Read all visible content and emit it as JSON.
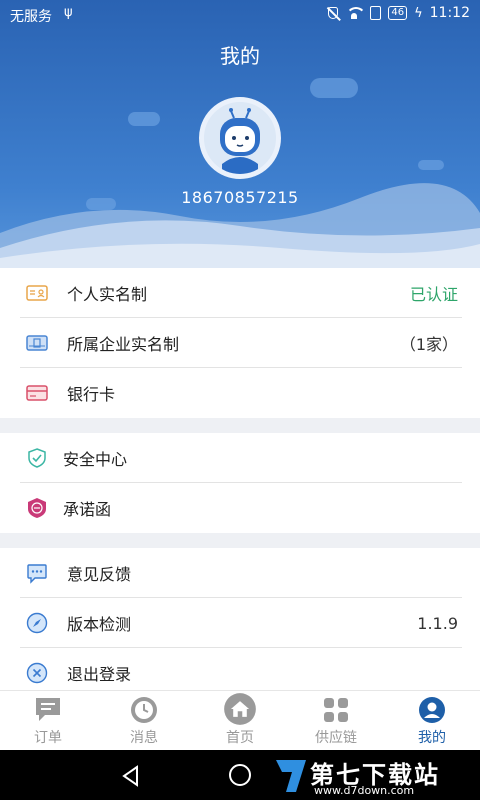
{
  "status_bar": {
    "carrier": "无服务",
    "usb_icon": "usb-icon",
    "network": "46",
    "time": "11:12"
  },
  "header": {
    "title": "我的",
    "phone": "18670857215"
  },
  "groups": [
    {
      "items": [
        {
          "label": "个人实名制",
          "value": "已认证",
          "icon": "id-card-icon"
        },
        {
          "label": "所属企业实名制",
          "value": "（1家）",
          "icon": "company-card-icon"
        },
        {
          "label": "银行卡",
          "value": "",
          "icon": "bank-card-icon"
        }
      ]
    },
    {
      "items": [
        {
          "label": "安全中心",
          "icon": "shield-check-icon"
        },
        {
          "label": "承诺函",
          "icon": "commitment-badge-icon"
        }
      ]
    },
    {
      "items": [
        {
          "label": "意见反馈",
          "icon": "feedback-icon"
        },
        {
          "label": "版本检测",
          "value": "1.1.9",
          "icon": "compass-icon"
        },
        {
          "label": "退出登录",
          "icon": "logout-icon"
        }
      ]
    }
  ],
  "tabs": [
    {
      "label": "订单",
      "icon": "orders-icon"
    },
    {
      "label": "消息",
      "icon": "clock-icon"
    },
    {
      "label": "首页",
      "icon": "home-icon"
    },
    {
      "label": "供应链",
      "icon": "grid-icon"
    },
    {
      "label": "我的",
      "icon": "profile-icon",
      "active": true
    }
  ],
  "colors": {
    "primary": "#2a63b3",
    "verified_green": "#2ea56a",
    "active_tab": "#1e5fa8"
  },
  "watermark": {
    "text": "第七下载站",
    "url": "www.d7down.com"
  }
}
